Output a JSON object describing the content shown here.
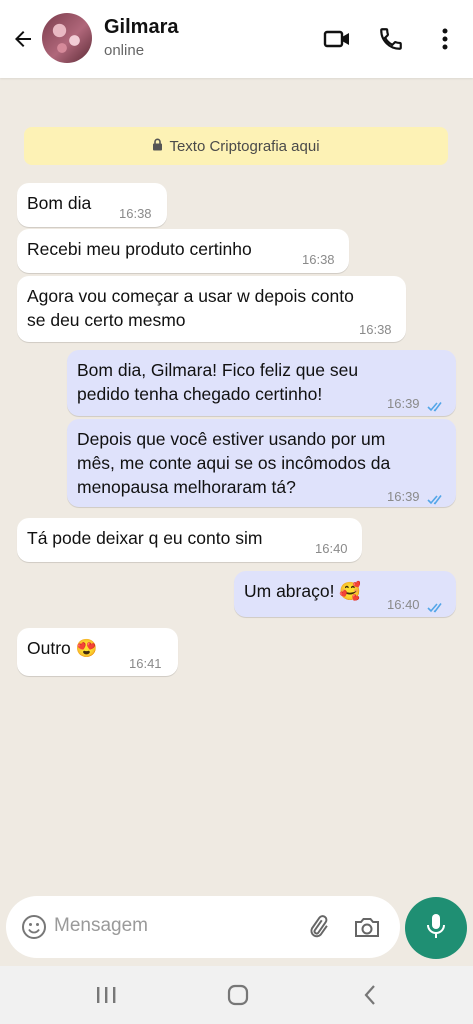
{
  "header": {
    "name": "Gilmara",
    "status": "online"
  },
  "encryption": {
    "text": "Texto Criptografia aqui"
  },
  "messages": [
    {
      "text": "Bom dia",
      "time": "16:38"
    },
    {
      "text": "Recebi meu produto certinho",
      "time": "16:38"
    },
    {
      "line1": "Agora vou começar a usar w depois conto",
      "line2": "se deu certo mesmo",
      "time": "16:38"
    },
    {
      "line1": "Bom dia, Gilmara! Fico feliz que seu",
      "line2": "pedido tenha chegado certinho!",
      "time": "16:39"
    },
    {
      "line1": "Depois que você estiver usando por um",
      "line2": "mês,  me conte aqui se os incômodos da",
      "line3": "menopausa melhoraram tá?",
      "time": "16:39"
    },
    {
      "text": "Tá pode deixar q eu conto sim",
      "time": "16:40"
    },
    {
      "text": "Um abraço! 🥰",
      "time": "16:40"
    },
    {
      "text": "Outro 😍",
      "time": "16:41"
    }
  ],
  "composer": {
    "placeholder": "Mensagem"
  },
  "colors": {
    "accent": "#1f8f73",
    "outgoing": "#dfe2fb",
    "read_ticks": "#53a6e8",
    "encryption_bg": "#fdf2b5"
  }
}
